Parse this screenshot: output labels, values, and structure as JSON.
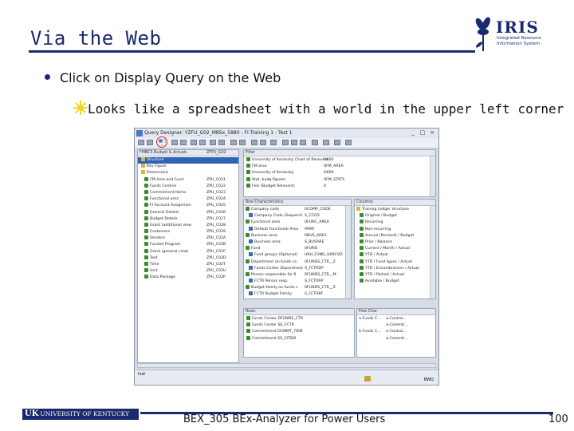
{
  "slide": {
    "title": "Via the Web",
    "bullet1_prefix": "Click on ",
    "bullet1_emph": "Display Query on the Web",
    "bullet2": "Looks like a spreadsheet with a world in the upper left corner",
    "footer": "BEX_305 BEx-Analyzer for Power Users",
    "page_number": "100"
  },
  "logos": {
    "iris_word": "IRIS",
    "iris_sub": "Integrated Resource Information System",
    "uk_mark": "UK",
    "uk_text": "UNIVERSITY OF KENTUCKY"
  },
  "colors": {
    "title_navy": "#1a2a6c",
    "highlight_ring": "#dd2222",
    "star_yellow": "#f2d21b",
    "selection_blue": "#2f63b8"
  },
  "screenshot": {
    "window_title": "Query Designer: YZFU_G02_MBSx_5880 - FI Training 1 - Test 1",
    "left_pane": {
      "header_col1": "FMBCS Budget & Actuals",
      "header_col2": "ZFPU_G02",
      "rows": [
        {
          "label": "Structure",
          "code": "",
          "selected": true,
          "icon": "f"
        },
        {
          "label": "Key Figure",
          "code": "",
          "icon": "f"
        },
        {
          "label": "Dimensions",
          "code": "",
          "icon": "f"
        },
        {
          "label": "FM Area and Fund",
          "code": "ZPU_C021",
          "icon": "g"
        },
        {
          "label": "Funds Centres",
          "code": "ZPU_C022",
          "icon": "g"
        },
        {
          "label": "Commitment Items",
          "code": "ZPU_C023",
          "icon": "g"
        },
        {
          "label": "Functional area",
          "code": "ZPU_C024",
          "icon": "g"
        },
        {
          "label": "FI Account Assignmen",
          "code": "ZPU_C025",
          "icon": "g"
        },
        {
          "label": "General Details",
          "code": "ZPU_C026",
          "icon": "g"
        },
        {
          "label": "Budget Details",
          "code": "ZPU_C027",
          "icon": "g"
        },
        {
          "label": "Grant (additional view",
          "code": "ZPU_C028",
          "icon": "g"
        },
        {
          "label": "Customers",
          "code": "ZPU_C029",
          "icon": "g"
        },
        {
          "label": "Vendors",
          "code": "ZPU_C02A",
          "icon": "g"
        },
        {
          "label": "Funded Program",
          "code": "ZPU_C02B",
          "icon": "g"
        },
        {
          "label": "Grant (general view)",
          "code": "ZPU_C02C",
          "icon": "g"
        },
        {
          "label": "Text",
          "code": "ZPU_C02D",
          "icon": "g"
        },
        {
          "label": "Time",
          "code": "ZPU_C02T",
          "icon": "g"
        },
        {
          "label": "Unit",
          "code": "ZPU_C02U",
          "icon": "g"
        },
        {
          "label": "Data Package",
          "code": "ZPU_C02P",
          "icon": "g"
        }
      ]
    },
    "filter_pane": {
      "header": "Filter",
      "rows": [
        {
          "label": "University of Kentucky Chart of Resource",
          "code": "UK00"
        },
        {
          "label": "FM area",
          "code": "0FM_AREA"
        },
        {
          "label": "University of Kentucky",
          "code": "UK00"
        },
        {
          "label": "Stat. budg figures",
          "code": "0FM_STATS"
        },
        {
          "label": "Flex (Budget Relevant)",
          "code": "0"
        }
      ]
    },
    "chars_pane": {
      "header": "Row Characteristics",
      "rows": [
        {
          "label": "Company code",
          "code": "0COMP_CODE"
        },
        {
          "label": "Company Code (Sequenti",
          "code": "S_CCCD"
        },
        {
          "label": "Functional area",
          "code": "0FUNC_AREA"
        },
        {
          "label": "Default Functional Area",
          "code": "9999"
        },
        {
          "label": "Business area",
          "code": "0BUS_AREA"
        },
        {
          "label": "Business area",
          "code": "S_BUSARE"
        },
        {
          "label": "Fund",
          "code": "0FUND"
        },
        {
          "label": "Fund groups (Optional)",
          "code": "UKH_FUND_UKRCVD"
        },
        {
          "label": "Department on funds ce",
          "code": "0FUNDS_CTR__Z"
        },
        {
          "label": "Funds Center Department",
          "code": "S_FCTRDP"
        },
        {
          "label": "Person responsible for fi",
          "code": "0FUNDS_CTR__M"
        },
        {
          "label": "FCTR Person resp.",
          "code": "S_FCTRRP"
        },
        {
          "label": "Budget family on funds c",
          "code": "0FUNDS_CTR__Z"
        },
        {
          "label": "FCTR Budget Family",
          "code": "S_FCTRBF"
        }
      ]
    },
    "columns_pane": {
      "header": "Columns",
      "rows": [
        "Training Ledger structure",
        "Original / Budget",
        "Recurring",
        "Non-recurring",
        "Annual (Revised) / Budget",
        "Prior / Balance",
        "Current / Month / Actual",
        "YTD / Actual",
        "YTD / Fund types / Actual",
        "YTD / Encumbrances / Actual",
        "YTD / Parked / Actual",
        "Available / Budget"
      ]
    },
    "rows_pane": {
      "header": "Rows",
      "rows": [
        "Funds Center DFUNDS_CTR",
        "Funds Center SE_FCTR",
        "Commitment DCMMT_ITEM",
        "Commitment SS_CITEM"
      ]
    },
    "free_pane": {
      "header": "Free Char.",
      "rows": [
        {
          "a": "a-Funds C...",
          "b": "a-Control..."
        },
        {
          "a": "",
          "b": "a-Commit..."
        },
        {
          "a": "b-Funds C...",
          "b": "a-Control..."
        },
        {
          "a": "",
          "b": "a-Commit..."
        }
      ]
    },
    "status_left": "Inst",
    "status_right": "BWQ"
  }
}
